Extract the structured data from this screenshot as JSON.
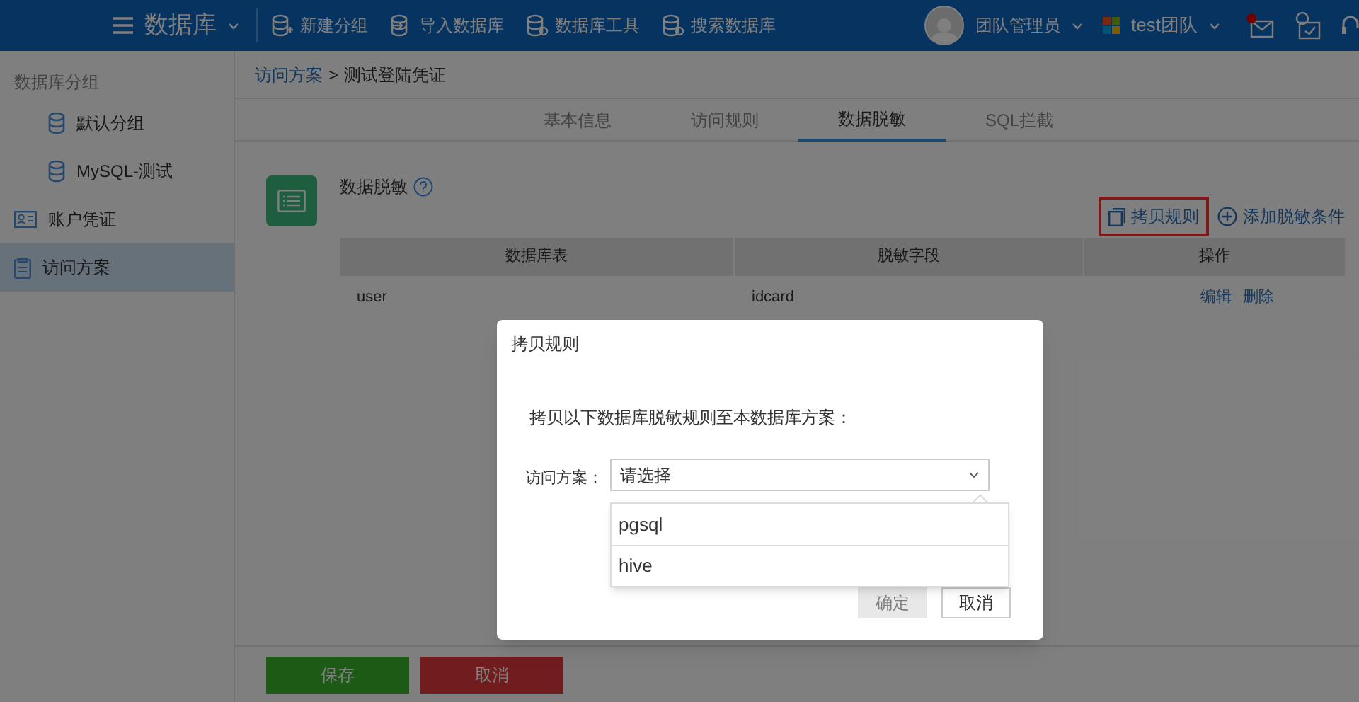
{
  "top_bar": {
    "app_menu": "数据库",
    "actions": [
      {
        "kind": "add",
        "label": "新建分组"
      },
      {
        "kind": "import",
        "label": "导入数据库"
      },
      {
        "kind": "tool",
        "label": "数据库工具"
      },
      {
        "kind": "search",
        "label": "搜索数据库"
      }
    ],
    "user": "团队管理员",
    "team": "test团队",
    "notifications": {
      "unread": true
    }
  },
  "sidebar": {
    "heading": "数据库分组",
    "items": [
      {
        "kind": "db",
        "label": "默认分组",
        "selected": false
      },
      {
        "kind": "db",
        "label": "MySQL-测试",
        "selected": false
      },
      {
        "kind": "account",
        "label": "账户凭证",
        "selected": false
      },
      {
        "kind": "plan",
        "label": "访问方案",
        "selected": true
      }
    ]
  },
  "breadcrumb": {
    "link": "访问方案",
    "separator": ">",
    "current": "测试登陆凭证"
  },
  "tabs": [
    {
      "label": "基本信息",
      "selected": false
    },
    {
      "label": "访问规则",
      "selected": false
    },
    {
      "label": "数据脱敏",
      "selected": true
    },
    {
      "label": "SQL拦截",
      "selected": false
    }
  ],
  "section": {
    "title": "数据脱敏",
    "copy_rule": {
      "label": "拷贝规则",
      "highlighted": true
    },
    "add_condition": "添加脱敏条件"
  },
  "table": {
    "columns": [
      "数据库表",
      "脱敏字段",
      "操作"
    ],
    "rows": [
      {
        "table": "user",
        "field": "idcard",
        "actions": [
          "编辑",
          "删除"
        ]
      }
    ]
  },
  "footer_buttons": [
    {
      "kind": "save",
      "label": "保存"
    },
    {
      "kind": "cancel",
      "label": "取消"
    }
  ],
  "dialog": {
    "title": "拷贝规则",
    "message": "拷贝以下数据库脱敏规则至本数据库方案：",
    "field_label": "访问方案：",
    "select": {
      "placeholder": "请选择",
      "expanded": true,
      "options": [
        "pgsql",
        "hive"
      ]
    },
    "buttons": [
      {
        "label": "确定",
        "disabled": true
      },
      {
        "label": "取消",
        "disabled": false
      }
    ]
  }
}
